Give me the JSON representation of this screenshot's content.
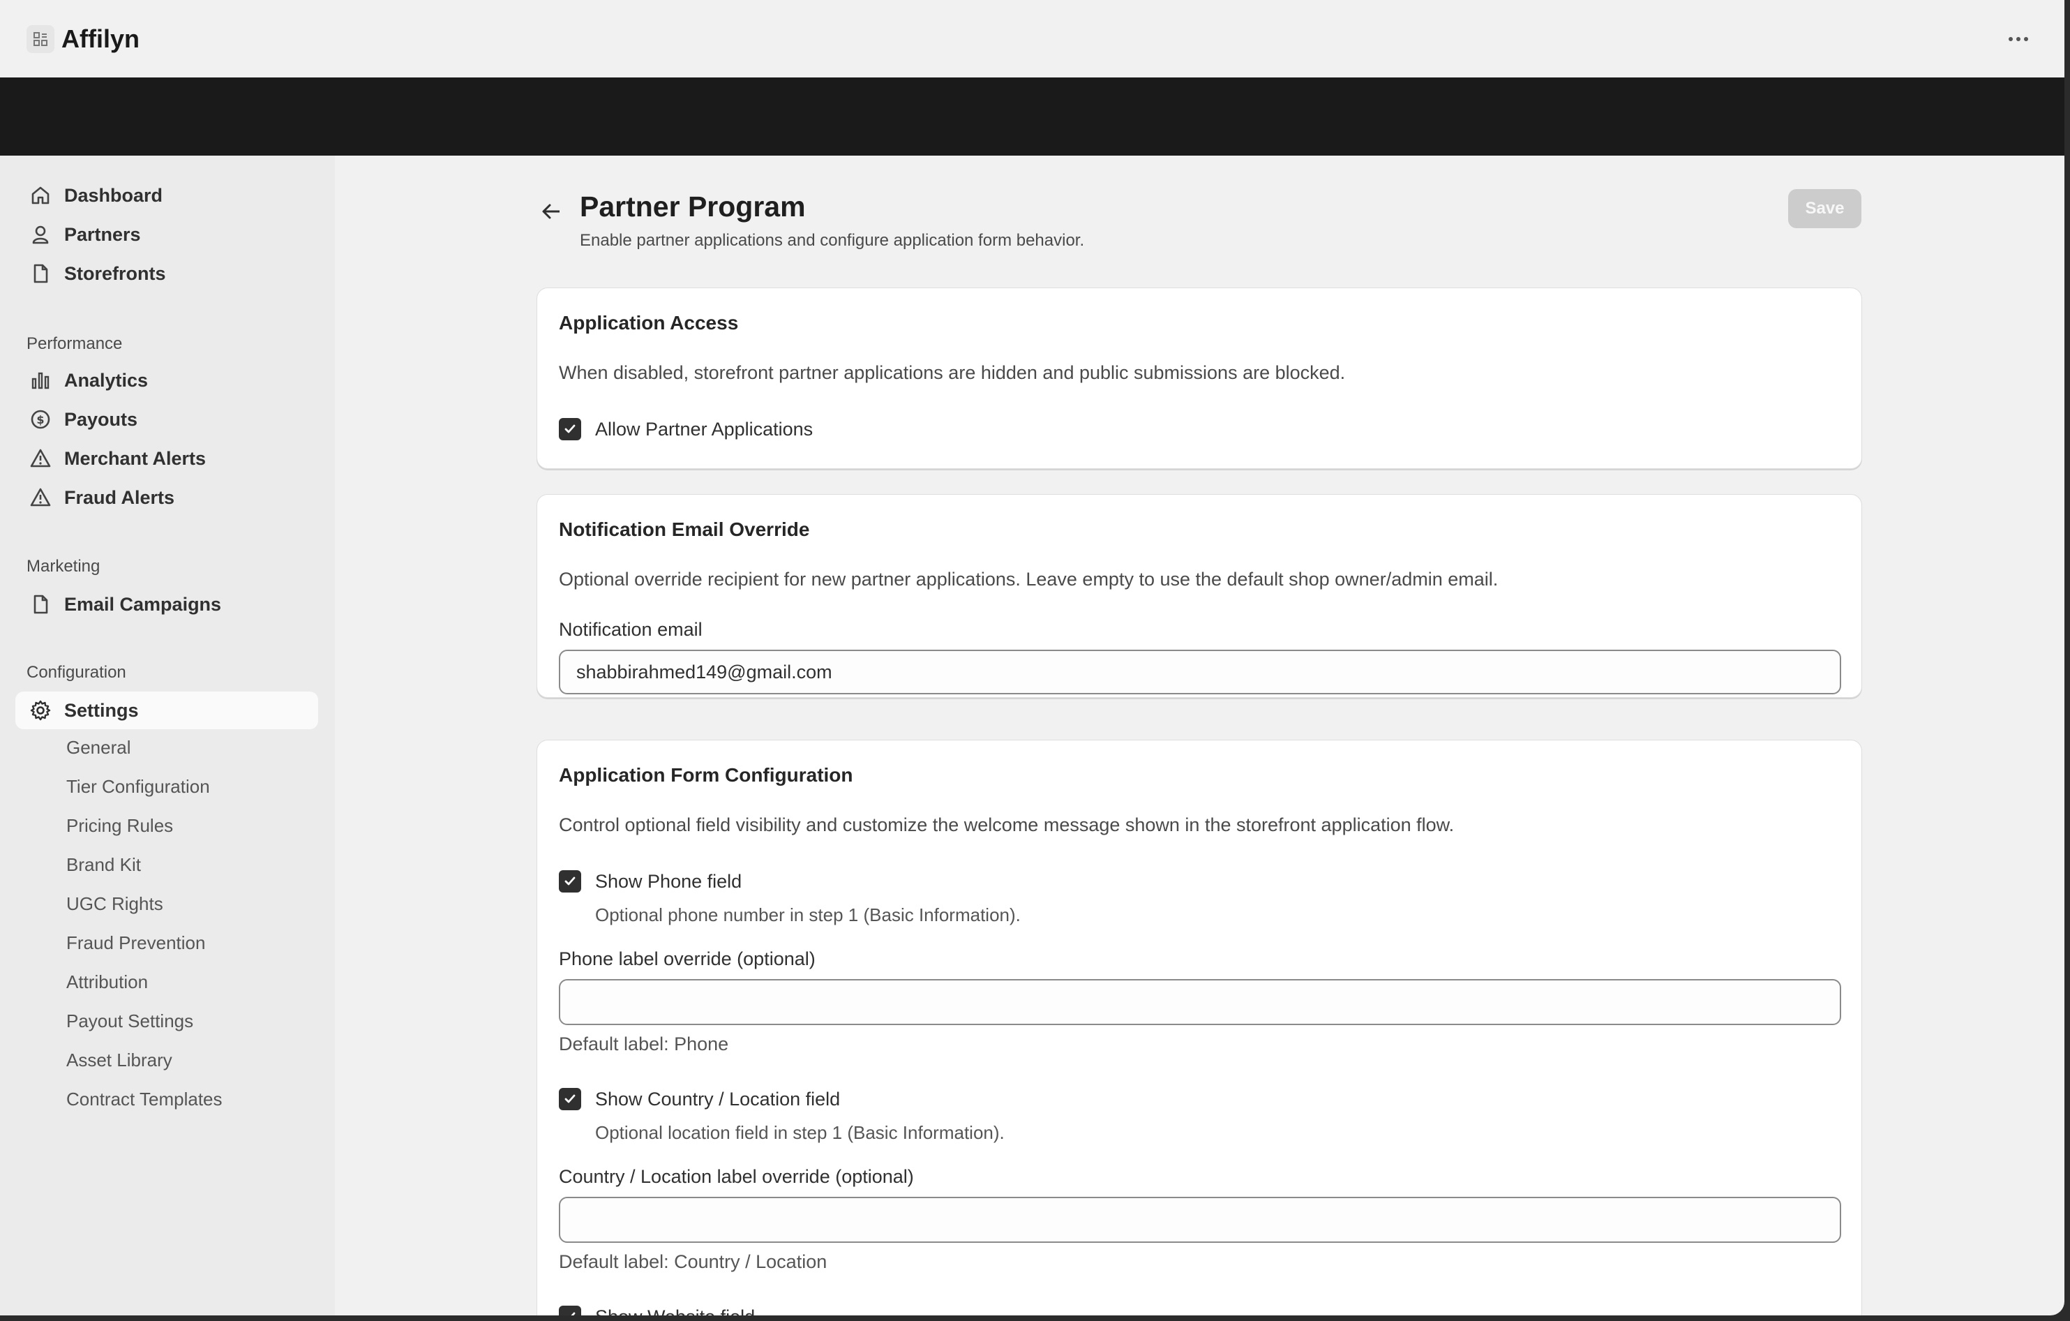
{
  "app": {
    "title": "Affilyn"
  },
  "sidebar": {
    "main_items": [
      {
        "label": "Dashboard",
        "icon": "home-icon"
      },
      {
        "label": "Partners",
        "icon": "person-icon"
      },
      {
        "label": "Storefronts",
        "icon": "document-icon"
      }
    ],
    "sections": [
      {
        "heading": "Performance",
        "items": [
          {
            "label": "Analytics",
            "icon": "bar-chart-icon"
          },
          {
            "label": "Payouts",
            "icon": "dollar-circle-icon"
          },
          {
            "label": "Merchant Alerts",
            "icon": "alert-triangle-icon"
          },
          {
            "label": "Fraud Alerts",
            "icon": "alert-triangle-icon"
          }
        ]
      },
      {
        "heading": "Marketing",
        "items": [
          {
            "label": "Email Campaigns",
            "icon": "document-icon"
          }
        ]
      },
      {
        "heading": "Configuration",
        "items": [
          {
            "label": "Settings",
            "icon": "gear-icon",
            "active": true
          }
        ]
      }
    ],
    "settings_subitems": [
      "General",
      "Tier Configuration",
      "Pricing Rules",
      "Brand Kit",
      "UGC Rights",
      "Fraud Prevention",
      "Attribution",
      "Payout Settings",
      "Asset Library",
      "Contract Templates"
    ]
  },
  "page": {
    "title": "Partner Program",
    "subtitle": "Enable partner applications and configure application form behavior.",
    "save_label": "Save"
  },
  "access_card": {
    "title": "Application Access",
    "description": "When disabled, storefront partner applications are hidden and public submissions are blocked.",
    "checkbox_label": "Allow Partner Applications",
    "checked": true
  },
  "email_card": {
    "title": "Notification Email Override",
    "description": "Optional override recipient for new partner applications. Leave empty to use the default shop owner/admin email.",
    "field_label": "Notification email",
    "field_value": "shabbirahmed149@gmail.com"
  },
  "form_card": {
    "title": "Application Form Configuration",
    "description": "Control optional field visibility and customize the welcome message shown in the storefront application flow.",
    "phone": {
      "checkbox_label": "Show Phone field",
      "help": "Optional phone number in step 1 (Basic Information).",
      "override_label": "Phone label override (optional)",
      "override_value": "",
      "default_note": "Default label: Phone"
    },
    "country": {
      "checkbox_label": "Show Country / Location field",
      "help": "Optional location field in step 1 (Basic Information).",
      "override_label": "Country / Location label override (optional)",
      "override_value": "",
      "default_note": "Default label: Country / Location"
    },
    "website": {
      "checkbox_label": "Show Website field"
    }
  }
}
